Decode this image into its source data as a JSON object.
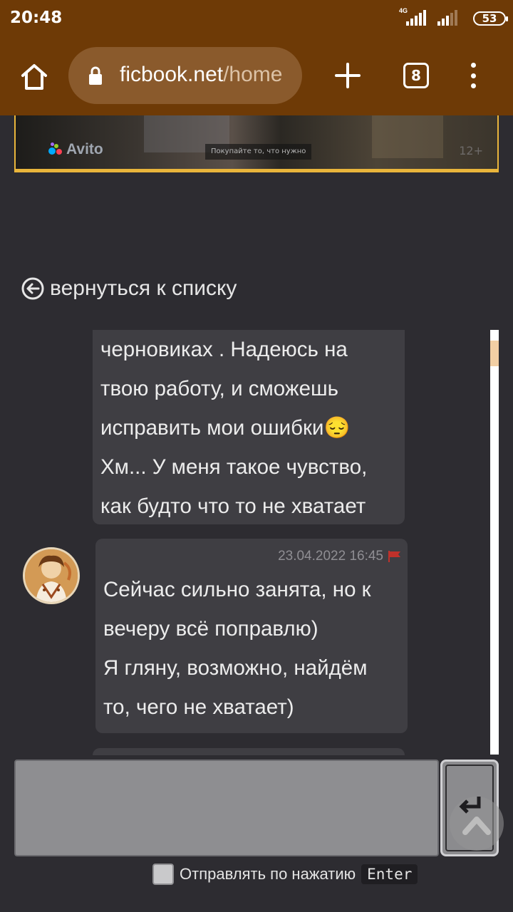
{
  "status_bar": {
    "time": "20:48",
    "network_type": "4G",
    "battery": "53"
  },
  "browser": {
    "url_domain": "ficbook.net",
    "url_path": "/home",
    "tab_count": "8",
    "icons": {
      "home": "home-icon",
      "lock": "lock-icon",
      "new_tab": "plus-icon",
      "menu": "more-vertical-icon"
    }
  },
  "ad": {
    "brand": "Avito",
    "slogan": "Покупайте то, что нужно",
    "age": "12+"
  },
  "nav": {
    "back_label": "вернуться к списку"
  },
  "messages": [
    {
      "lines": [
        "черновиках . Надеюсь на",
        "твою работу, и сможешь",
        "исправить мои ошибки😔",
        "Хм... У меня такое чувство,",
        "как будто что то не хватает"
      ]
    },
    {
      "timestamp": "23.04.2022 16:45",
      "lines": [
        "Сейчас сильно занята, но к",
        "вечеру всё поправлю)",
        "Я гляну, возможно, найдём",
        "то, чего не хватает)"
      ]
    }
  ],
  "composer": {
    "value": "",
    "send_on_enter_label": "Отправлять по нажатию",
    "enter_key": "Enter",
    "send_on_enter_checked": false
  },
  "colors": {
    "toolbar": "#6e3a06",
    "page_bg": "#2d2c31",
    "bubble_bg": "#3f3e43",
    "accent": "#e9b53b",
    "report_flag": "#c0312b"
  }
}
